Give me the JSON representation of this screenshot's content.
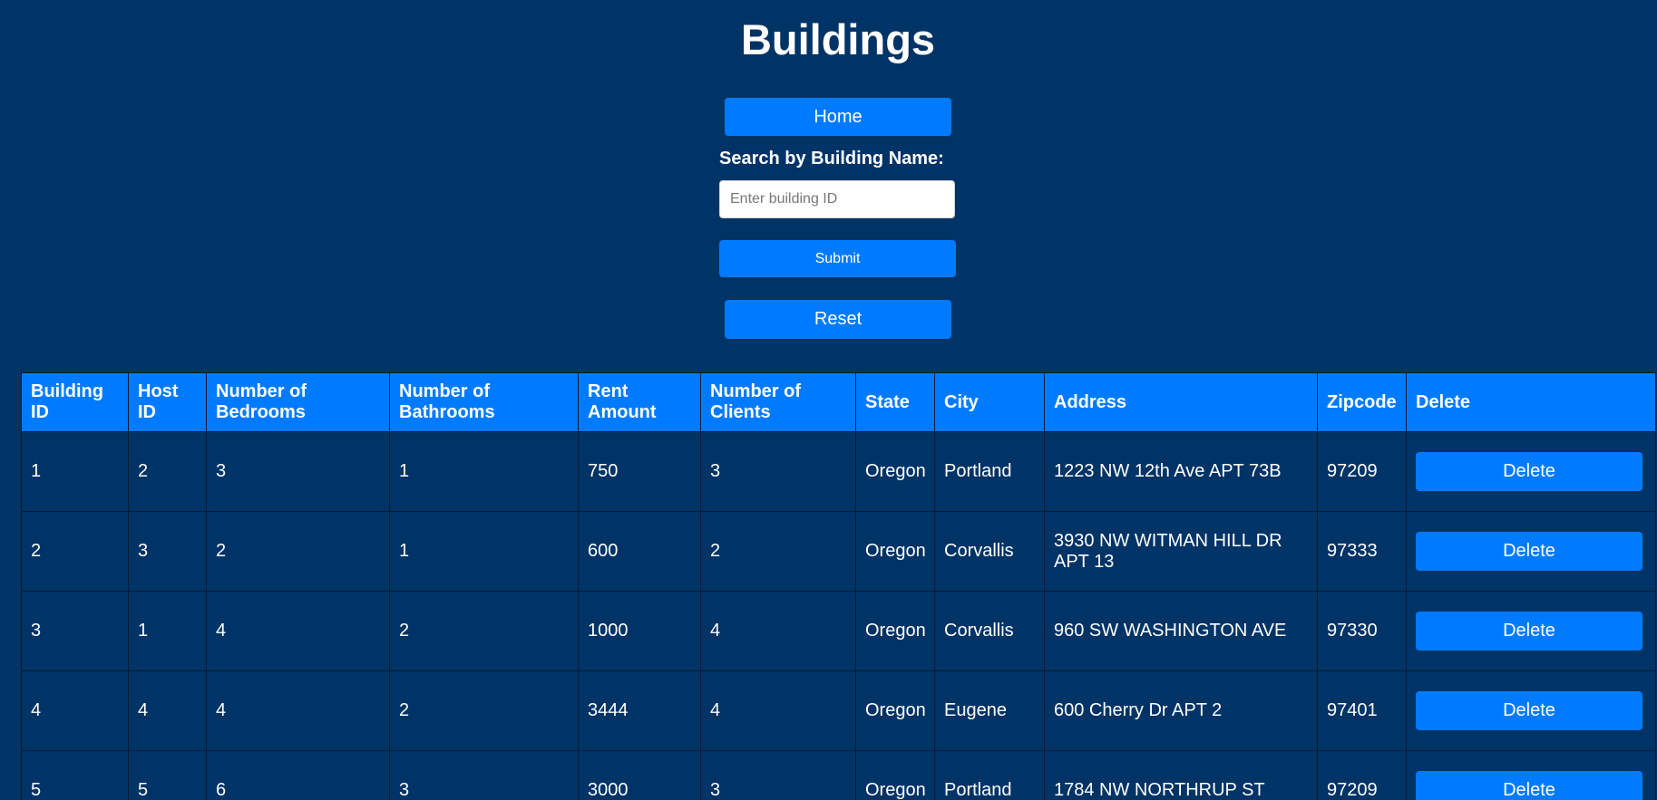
{
  "page": {
    "title": "Buildings"
  },
  "nav": {
    "home_label": "Home"
  },
  "search": {
    "label": "Search by Building Name:",
    "placeholder": "Enter building ID",
    "value": "",
    "submit_label": "Submit",
    "reset_label": "Reset"
  },
  "table": {
    "headers": [
      "Building ID",
      "Host ID",
      "Number of Bedrooms",
      "Number of Bathrooms",
      "Rent Amount",
      "Number of Clients",
      "State",
      "City",
      "Address",
      "Zipcode",
      "Delete"
    ],
    "rows": [
      {
        "building_id": "1",
        "host_id": "2",
        "bedrooms": "3",
        "bathrooms": "1",
        "rent": "750",
        "clients": "3",
        "state": "Oregon",
        "city": "Portland",
        "address": "1223 NW 12th Ave APT 73B",
        "zipcode": "97209",
        "delete_label": "Delete"
      },
      {
        "building_id": "2",
        "host_id": "3",
        "bedrooms": "2",
        "bathrooms": "1",
        "rent": "600",
        "clients": "2",
        "state": "Oregon",
        "city": "Corvallis",
        "address": "3930 NW WITMAN HILL DR APT 13",
        "zipcode": "97333",
        "delete_label": "Delete"
      },
      {
        "building_id": "3",
        "host_id": "1",
        "bedrooms": "4",
        "bathrooms": "2",
        "rent": "1000",
        "clients": "4",
        "state": "Oregon",
        "city": "Corvallis",
        "address": "960 SW WASHINGTON AVE",
        "zipcode": "97330",
        "delete_label": "Delete"
      },
      {
        "building_id": "4",
        "host_id": "4",
        "bedrooms": "4",
        "bathrooms": "2",
        "rent": "3444",
        "clients": "4",
        "state": "Oregon",
        "city": "Eugene",
        "address": "600 Cherry Dr APT 2",
        "zipcode": "97401",
        "delete_label": "Delete"
      },
      {
        "building_id": "5",
        "host_id": "5",
        "bedrooms": "6",
        "bathrooms": "3",
        "rent": "3000",
        "clients": "3",
        "state": "Oregon",
        "city": "Portland",
        "address": "1784 NW NORTHRUP ST",
        "zipcode": "97209",
        "delete_label": "Delete"
      }
    ]
  },
  "colors": {
    "background": "#003366",
    "accent": "#007bff",
    "text": "#ffffff"
  }
}
